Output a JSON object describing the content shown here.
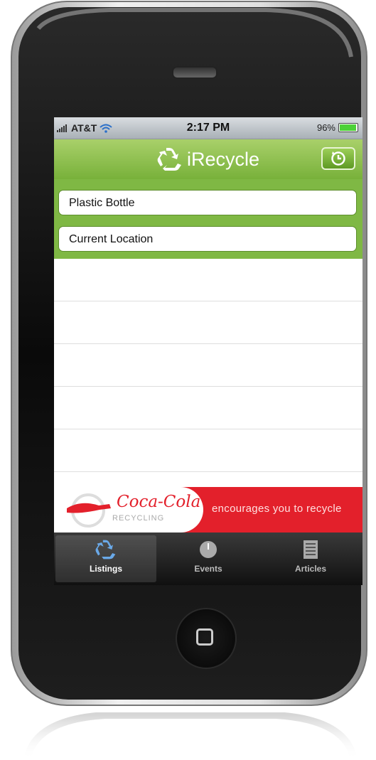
{
  "status": {
    "carrier": "AT&T",
    "time": "2:17 PM",
    "battery": "96%",
    "battery_level": 0.96
  },
  "nav": {
    "title": "iRecycle",
    "history_icon": "clock-icon"
  },
  "search": {
    "material_value": "Plastic Bottle",
    "location_value": "Current Location"
  },
  "list": {
    "rows": 5
  },
  "ad": {
    "brand": "Coca-Cola",
    "brand_sub": "RECYCLING",
    "text": "encourages you to recycle"
  },
  "tabs": [
    {
      "label": "Listings",
      "icon": "recycle-icon"
    },
    {
      "label": "Events",
      "icon": "clock-icon"
    },
    {
      "label": "Articles",
      "icon": "document-icon"
    }
  ],
  "colors": {
    "green": "#7fb844",
    "red": "#e3202b"
  }
}
